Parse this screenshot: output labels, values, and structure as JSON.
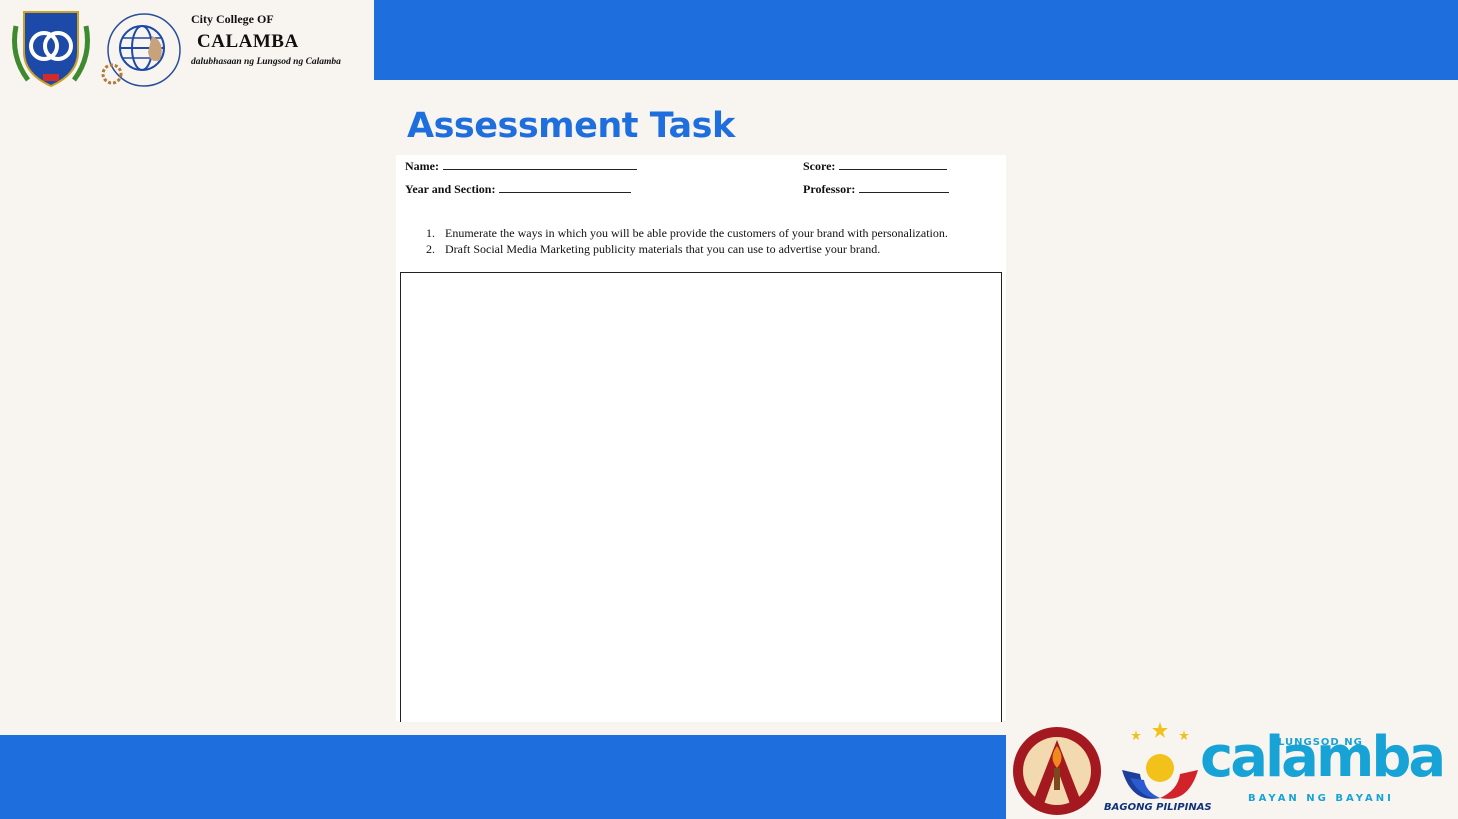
{
  "header": {
    "college_line1": "City College OF",
    "college_line2": "CALAMBA",
    "college_line3": "dalubhasaan ng Lungsod ng Calamba",
    "seal_text": "City College of Calamba"
  },
  "slide": {
    "title": "Assessment Task"
  },
  "document": {
    "name_label": "Name:",
    "score_label": "Score:",
    "year_section_label": "Year and Section:",
    "professor_label": "Professor:",
    "tasks": [
      {
        "num": "1.",
        "text": "Enumerate the ways in which you will be able provide the customers of your brand with personalization."
      },
      {
        "num": "2.",
        "text": "Draft Social Media Marketing publicity materials that you can use to advertise your brand."
      }
    ]
  },
  "footer_logos": {
    "bagong_pilipinas": "BAGONG PILIPINAS",
    "lungsod_ng": "LUNGSOD NG",
    "calamba": "calamba",
    "bayan_ng_bayani": "BAYAN NG BAYANI"
  },
  "colors": {
    "brand_blue": "#1f6edd",
    "calamba_cyan": "#17a3d6",
    "background": "#f8f5f0"
  }
}
